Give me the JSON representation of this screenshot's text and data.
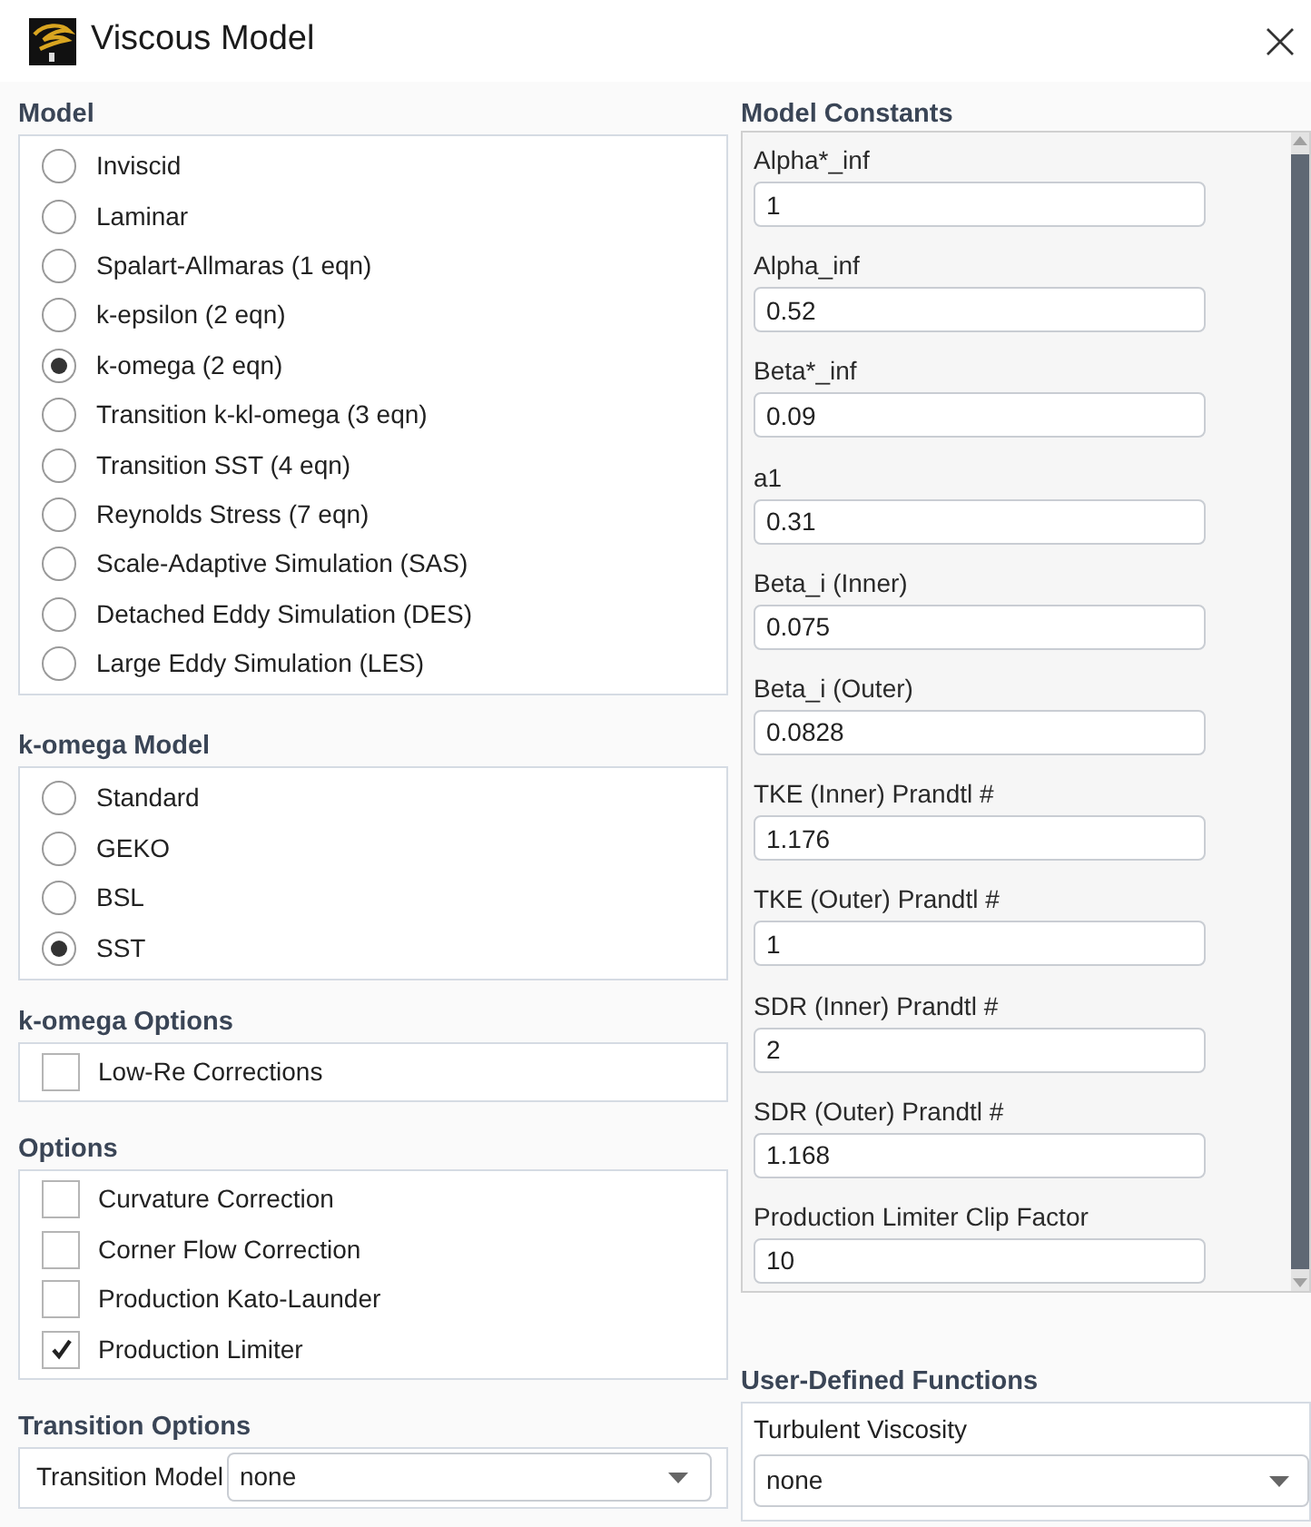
{
  "window": {
    "title": "Viscous Model"
  },
  "model": {
    "title": "Model",
    "options": [
      {
        "label": "Inviscid",
        "selected": false
      },
      {
        "label": "Laminar",
        "selected": false
      },
      {
        "label": "Spalart-Allmaras (1 eqn)",
        "selected": false
      },
      {
        "label": "k-epsilon (2 eqn)",
        "selected": false
      },
      {
        "label": "k-omega (2 eqn)",
        "selected": true
      },
      {
        "label": "Transition k-kl-omega (3 eqn)",
        "selected": false
      },
      {
        "label": "Transition SST (4 eqn)",
        "selected": false
      },
      {
        "label": "Reynolds Stress (7 eqn)",
        "selected": false
      },
      {
        "label": "Scale-Adaptive Simulation (SAS)",
        "selected": false
      },
      {
        "label": "Detached Eddy Simulation (DES)",
        "selected": false
      },
      {
        "label": "Large Eddy Simulation (LES)",
        "selected": false
      }
    ]
  },
  "k_omega_model": {
    "title": "k-omega Model",
    "options": [
      {
        "label": "Standard",
        "selected": false
      },
      {
        "label": "GEKO",
        "selected": false
      },
      {
        "label": "BSL",
        "selected": false
      },
      {
        "label": "SST",
        "selected": true
      }
    ]
  },
  "k_omega_options": {
    "title": "k-omega Options",
    "options": [
      {
        "label": "Low-Re Corrections",
        "checked": false
      }
    ]
  },
  "options": {
    "title": "Options",
    "options": [
      {
        "label": "Curvature Correction",
        "checked": false
      },
      {
        "label": "Corner Flow Correction",
        "checked": false
      },
      {
        "label": "Production Kato-Launder",
        "checked": false
      },
      {
        "label": "Production Limiter",
        "checked": true
      }
    ]
  },
  "transition_options": {
    "title": "Transition Options",
    "field": {
      "label": "Transition Model",
      "value": "none"
    }
  },
  "model_constants": {
    "title": "Model Constants",
    "fields": [
      {
        "label": "Alpha*_inf",
        "value": "1"
      },
      {
        "label": "Alpha_inf",
        "value": "0.52"
      },
      {
        "label": "Beta*_inf",
        "value": "0.09"
      },
      {
        "label": "a1",
        "value": "0.31"
      },
      {
        "label": "Beta_i (Inner)",
        "value": "0.075"
      },
      {
        "label": "Beta_i (Outer)",
        "value": "0.0828"
      },
      {
        "label": "TKE (Inner) Prandtl #",
        "value": "1.176"
      },
      {
        "label": "TKE (Outer) Prandtl #",
        "value": "1"
      },
      {
        "label": "SDR (Inner) Prandtl #",
        "value": "2"
      },
      {
        "label": "SDR (Outer) Prandtl #",
        "value": "1.168"
      },
      {
        "label": "Production Limiter Clip Factor",
        "value": "10"
      }
    ]
  },
  "user_defined_functions": {
    "title": "User-Defined Functions",
    "field": {
      "label": "Turbulent Viscosity",
      "value": "none"
    }
  }
}
